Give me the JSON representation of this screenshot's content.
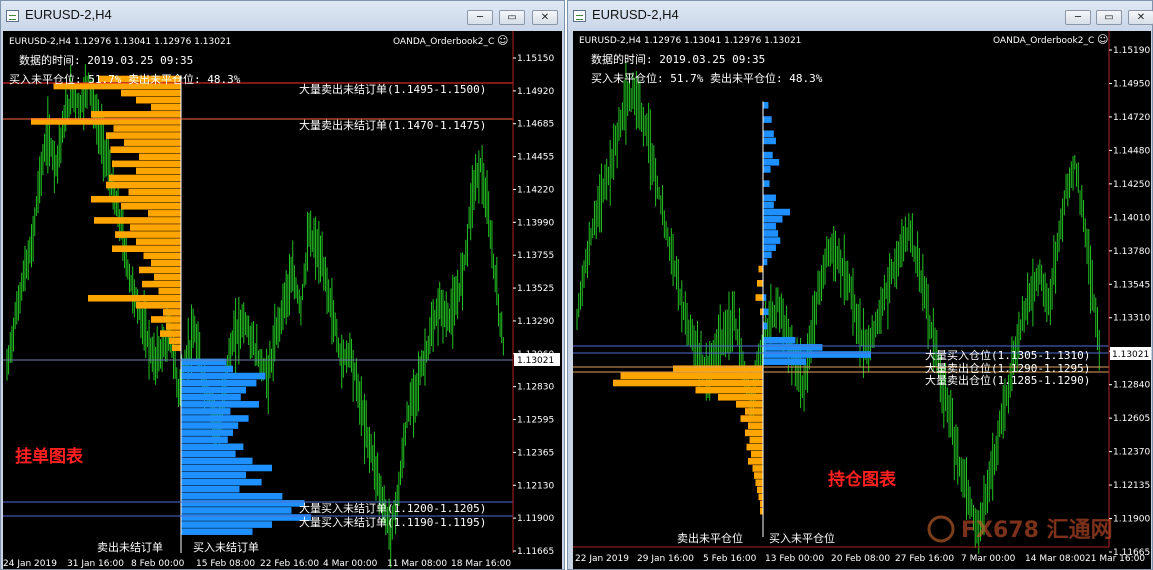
{
  "colors": {
    "ask": "#FFA500",
    "bid": "#1E90FF",
    "candle": "#22C322",
    "grid": "#FFFFFF",
    "highlight_red": "#FF2020",
    "line_blue": "#4E6FD0",
    "line_orange": "#E0A05A",
    "price_marker": "#FFFFFF"
  },
  "windows": [
    {
      "title": "EURUSD-2,H4",
      "buttons": {
        "minimize": "─",
        "maximize": "▭",
        "close": "✕"
      },
      "header": {
        "symbol_line": "EURUSD-2,H4  1.12976 1.13041 1.12976 1.13021",
        "indicator": "OANDA_Orderbook2_C",
        "smiley_icon": "☺"
      },
      "info_lines": [
        "数据的时间: 2019.03.25 09:35",
        "买入未平仓位: 51.7%  卖出未平仓位: 48.3%"
      ],
      "annotations": [
        "大量卖出未结订单(1.1495-1.1500)",
        "大量卖出未结订单(1.1470-1.1475)",
        "大量买入未结订单(1.1200-1.1205)",
        "大量买入未结订单(1.1190-1.1195)"
      ],
      "red_label": "挂单图表",
      "bottom_labels": [
        "卖出未结订单",
        "买入未结订单"
      ],
      "price_axis": [
        "1.15150",
        "1.14920",
        "1.14685",
        "1.14455",
        "1.14220",
        "1.13990",
        "1.13755",
        "1.13525",
        "1.13290",
        "1.13060",
        "1.12830",
        "1.12595",
        "1.12365",
        "1.12130",
        "1.11900",
        "1.11665"
      ],
      "current_price": "1.13021",
      "time_axis": [
        "24 Jan 2019",
        "31 Jan 16:00",
        "8 Feb 00:00",
        "15 Feb 08:00",
        "22 Feb 16:00",
        "4 Mar 00:00",
        "11 Mar 08:00",
        "18 Mar 16:00"
      ]
    },
    {
      "title": "EURUSD-2,H4",
      "buttons": {
        "minimize": "─",
        "maximize": "▭",
        "close": "✕"
      },
      "header": {
        "symbol_line": "EURUSD-2,H4  1.12976 1.13041 1.12976 1.13021",
        "indicator": "OANDA_Orderbook2_C",
        "smiley_icon": "☺"
      },
      "info_lines": [
        "数据的时间: 2019.03.25 09:35",
        "买入未平仓位: 51.7%  卖出未平仓位: 48.3%"
      ],
      "annotations": [
        "大量买入仓位(1.1305-1.1310)",
        "大量卖出仓位(1.1290-1.1295)",
        "大量卖出仓位(1.1285-1.1290)"
      ],
      "red_label": "持仓图表",
      "bottom_labels": [
        "卖出未平仓位",
        "买入未平仓位"
      ],
      "price_axis": [
        "1.15190",
        "1.14950",
        "1.14720",
        "1.14480",
        "1.14250",
        "1.14010",
        "1.13780",
        "1.13545",
        "1.13310",
        "1.13075",
        "1.12840",
        "1.12605",
        "1.12370",
        "1.12135",
        "1.11900",
        "1.11665"
      ],
      "current_price": "1.13021",
      "time_axis": [
        "22 Jan 2019",
        "29 Jan 16:00",
        "5 Feb 16:00",
        "13 Feb 00:00",
        "20 Feb 08:00",
        "27 Feb 16:00",
        "7 Mar 00:00",
        "14 Mar 08:00",
        "21 Mar 16:00"
      ],
      "watermark": "FX678 汇通网"
    }
  ],
  "profiles": {
    "left_ask_levels": [
      {
        "price": 1.15,
        "volume": 0.55
      },
      {
        "price": 1.1495,
        "volume": 0.85
      },
      {
        "price": 1.149,
        "volume": 0.4
      },
      {
        "price": 1.1485,
        "volume": 0.3
      },
      {
        "price": 1.148,
        "volume": 0.2
      },
      {
        "price": 1.1475,
        "volume": 0.6
      },
      {
        "price": 1.147,
        "volume": 1.0
      },
      {
        "price": 1.1465,
        "volume": 0.45
      },
      {
        "price": 1.146,
        "volume": 0.5
      },
      {
        "price": 1.1455,
        "volume": 0.38
      },
      {
        "price": 1.145,
        "volume": 0.47
      },
      {
        "price": 1.1445,
        "volume": 0.28
      },
      {
        "price": 1.144,
        "volume": 0.46
      },
      {
        "price": 1.1435,
        "volume": 0.3
      },
      {
        "price": 1.143,
        "volume": 0.48
      },
      {
        "price": 1.1425,
        "volume": 0.5
      },
      {
        "price": 1.142,
        "volume": 0.35
      },
      {
        "price": 1.1415,
        "volume": 0.6
      },
      {
        "price": 1.141,
        "volume": 0.4
      },
      {
        "price": 1.1405,
        "volume": 0.22
      },
      {
        "price": 1.14,
        "volume": 0.58
      },
      {
        "price": 1.1395,
        "volume": 0.34
      },
      {
        "price": 1.139,
        "volume": 0.44
      },
      {
        "price": 1.1385,
        "volume": 0.3
      },
      {
        "price": 1.138,
        "volume": 0.46
      },
      {
        "price": 1.1375,
        "volume": 0.25
      },
      {
        "price": 1.137,
        "volume": 0.2
      },
      {
        "price": 1.1365,
        "volume": 0.28
      },
      {
        "price": 1.136,
        "volume": 0.18
      },
      {
        "price": 1.1355,
        "volume": 0.26
      },
      {
        "price": 1.135,
        "volume": 0.15
      },
      {
        "price": 1.1345,
        "volume": 0.62
      },
      {
        "price": 1.134,
        "volume": 0.3
      },
      {
        "price": 1.1335,
        "volume": 0.12
      },
      {
        "price": 1.133,
        "volume": 0.2
      },
      {
        "price": 1.1325,
        "volume": 0.1
      },
      {
        "price": 1.132,
        "volume": 0.14
      },
      {
        "price": 1.1315,
        "volume": 0.08
      },
      {
        "price": 1.131,
        "volume": 0.06
      }
    ],
    "left_bid_levels": [
      {
        "price": 1.13,
        "volume": 0.35
      },
      {
        "price": 1.1295,
        "volume": 0.4
      },
      {
        "price": 1.129,
        "volume": 0.65
      },
      {
        "price": 1.1285,
        "volume": 0.58
      },
      {
        "price": 1.128,
        "volume": 0.5
      },
      {
        "price": 1.1275,
        "volume": 0.46
      },
      {
        "price": 1.127,
        "volume": 0.6
      },
      {
        "price": 1.1265,
        "volume": 0.38
      },
      {
        "price": 1.126,
        "volume": 0.52
      },
      {
        "price": 1.1255,
        "volume": 0.44
      },
      {
        "price": 1.125,
        "volume": 0.4
      },
      {
        "price": 1.1245,
        "volume": 0.36
      },
      {
        "price": 1.124,
        "volume": 0.48
      },
      {
        "price": 1.1235,
        "volume": 0.42
      },
      {
        "price": 1.123,
        "volume": 0.55
      },
      {
        "price": 1.1225,
        "volume": 0.7
      },
      {
        "price": 1.122,
        "volume": 0.5
      },
      {
        "price": 1.1215,
        "volume": 0.62
      },
      {
        "price": 1.121,
        "volume": 0.45
      },
      {
        "price": 1.1205,
        "volume": 0.78
      },
      {
        "price": 1.12,
        "volume": 0.95
      },
      {
        "price": 1.1195,
        "volume": 0.85
      },
      {
        "price": 1.119,
        "volume": 1.0
      },
      {
        "price": 1.1185,
        "volume": 0.7
      },
      {
        "price": 1.118,
        "volume": 0.55
      }
    ],
    "right_buy_levels": [
      {
        "price": 1.148,
        "volume": 0.05
      },
      {
        "price": 1.147,
        "volume": 0.08
      },
      {
        "price": 1.146,
        "volume": 0.1
      },
      {
        "price": 1.1455,
        "volume": 0.12
      },
      {
        "price": 1.1445,
        "volume": 0.09
      },
      {
        "price": 1.144,
        "volume": 0.15
      },
      {
        "price": 1.1435,
        "volume": 0.07
      },
      {
        "price": 1.1425,
        "volume": 0.06
      },
      {
        "price": 1.1415,
        "volume": 0.12
      },
      {
        "price": 1.141,
        "volume": 0.1
      },
      {
        "price": 1.1405,
        "volume": 0.25
      },
      {
        "price": 1.14,
        "volume": 0.18
      },
      {
        "price": 1.1395,
        "volume": 0.12
      },
      {
        "price": 1.139,
        "volume": 0.14
      },
      {
        "price": 1.1385,
        "volume": 0.16
      },
      {
        "price": 1.138,
        "volume": 0.12
      },
      {
        "price": 1.1375,
        "volume": 0.08
      },
      {
        "price": 1.137,
        "volume": 0.04
      },
      {
        "price": 1.1345,
        "volume": 0.03
      },
      {
        "price": 1.1335,
        "volume": 0.05
      },
      {
        "price": 1.1325,
        "volume": 0.04
      },
      {
        "price": 1.1315,
        "volume": 0.3
      },
      {
        "price": 1.131,
        "volume": 0.55
      },
      {
        "price": 1.1305,
        "volume": 1.0
      },
      {
        "price": 1.13,
        "volume": 0.4
      }
    ],
    "right_sell_levels": [
      {
        "price": 1.1365,
        "volume": 0.03
      },
      {
        "price": 1.1355,
        "volume": 0.04
      },
      {
        "price": 1.1345,
        "volume": 0.05
      },
      {
        "price": 1.1335,
        "volume": 0.02
      },
      {
        "price": 1.1295,
        "volume": 0.6
      },
      {
        "price": 1.129,
        "volume": 0.95
      },
      {
        "price": 1.1285,
        "volume": 1.0
      },
      {
        "price": 1.128,
        "volume": 0.45
      },
      {
        "price": 1.1275,
        "volume": 0.3
      },
      {
        "price": 1.127,
        "volume": 0.18
      },
      {
        "price": 1.1265,
        "volume": 0.12
      },
      {
        "price": 1.126,
        "volume": 0.15
      },
      {
        "price": 1.1255,
        "volume": 0.1
      },
      {
        "price": 1.125,
        "volume": 0.12
      },
      {
        "price": 1.1245,
        "volume": 0.09
      },
      {
        "price": 1.124,
        "volume": 0.11
      },
      {
        "price": 1.1235,
        "volume": 0.08
      },
      {
        "price": 1.123,
        "volume": 0.1
      },
      {
        "price": 1.1225,
        "volume": 0.07
      },
      {
        "price": 1.122,
        "volume": 0.06
      },
      {
        "price": 1.1215,
        "volume": 0.05
      },
      {
        "price": 1.121,
        "volume": 0.04
      },
      {
        "price": 1.1205,
        "volume": 0.03
      },
      {
        "price": 1.12,
        "volume": 0.02
      },
      {
        "price": 1.1195,
        "volume": 0.02
      }
    ]
  },
  "series": {
    "left_closes": [
      1.1295,
      1.133,
      1.136,
      1.138,
      1.143,
      1.146,
      1.144,
      1.147,
      1.149,
      1.148,
      1.15,
      1.147,
      1.145,
      1.142,
      1.1395,
      1.136,
      1.134,
      1.132,
      1.13,
      1.131,
      1.132,
      1.128,
      1.1305,
      1.132,
      1.129,
      1.127,
      1.125,
      1.13,
      1.132,
      1.133,
      1.1315,
      1.13,
      1.129,
      1.132,
      1.1345,
      1.136,
      1.134,
      1.139,
      1.138,
      1.136,
      1.133,
      1.13,
      1.131,
      1.128,
      1.125,
      1.123,
      1.12,
      1.118,
      1.121,
      1.126,
      1.128,
      1.13,
      1.132,
      1.134,
      1.133,
      1.134,
      1.137,
      1.142,
      1.144,
      1.14,
      1.135,
      1.13
    ],
    "right_closes": [
      1.133,
      1.137,
      1.14,
      1.142,
      1.144,
      1.147,
      1.149,
      1.148,
      1.146,
      1.143,
      1.14,
      1.137,
      1.134,
      1.132,
      1.13,
      1.129,
      1.131,
      1.132,
      1.133,
      1.13,
      1.127,
      1.131,
      1.1325,
      1.134,
      1.132,
      1.13,
      1.128,
      1.133,
      1.136,
      1.138,
      1.137,
      1.136,
      1.133,
      1.131,
      1.132,
      1.134,
      1.136,
      1.138,
      1.139,
      1.137,
      1.134,
      1.131,
      1.128,
      1.125,
      1.122,
      1.12,
      1.118,
      1.121,
      1.124,
      1.127,
      1.13,
      1.133,
      1.135,
      1.136,
      1.134,
      1.138,
      1.142,
      1.144,
      1.14,
      1.135,
      1.13
    ]
  }
}
